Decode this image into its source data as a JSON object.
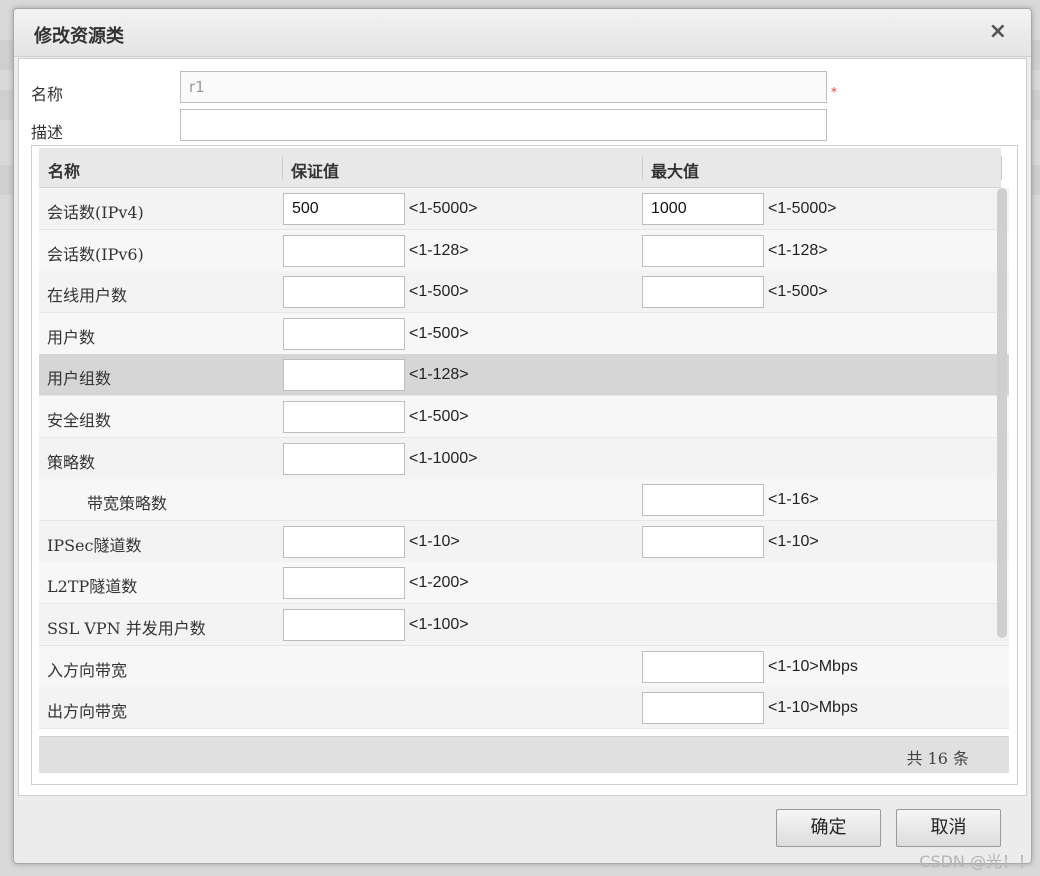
{
  "dialog": {
    "title": "修改资源类",
    "close_glyph": "×"
  },
  "form": {
    "name_label": "名称",
    "name_value": "r1",
    "required_mark": "*",
    "desc_label": "描述",
    "desc_value": ""
  },
  "grid": {
    "columns": {
      "name": "名称",
      "guarantee": "保证值",
      "max": "最大值"
    },
    "rows": [
      {
        "name": "会话数(IPv4)",
        "guarantee": "500",
        "guarantee_range": "<1-5000>",
        "max": "1000",
        "max_range": "<1-5000>"
      },
      {
        "name": "会话数(IPv6)",
        "guarantee": "",
        "guarantee_range": "<1-128>",
        "max": "",
        "max_range": "<1-128>"
      },
      {
        "name": "在线用户数",
        "guarantee": "",
        "guarantee_range": "<1-500>",
        "max": "",
        "max_range": "<1-500>"
      },
      {
        "name": "用户数",
        "guarantee": "",
        "guarantee_range": "<1-500>"
      },
      {
        "name": "用户组数",
        "guarantee": "",
        "guarantee_range": "<1-128>"
      },
      {
        "name": "安全组数",
        "guarantee": "",
        "guarantee_range": "<1-500>"
      },
      {
        "name": "策略数",
        "guarantee": "",
        "guarantee_range": "<1-1000>"
      },
      {
        "name": "带宽策略数",
        "max": "",
        "max_range": "<1-16>"
      },
      {
        "name": "IPSec隧道数",
        "guarantee": "",
        "guarantee_range": "<1-10>",
        "max": "",
        "max_range": "<1-10>"
      },
      {
        "name": "L2TP隧道数",
        "guarantee": "",
        "guarantee_range": "<1-200>"
      },
      {
        "name": "SSL VPN 并发用户数",
        "guarantee": "",
        "guarantee_range": "<1-100>"
      },
      {
        "name": "入方向带宽",
        "max": "",
        "max_range": "<1-10>Mbps"
      },
      {
        "name": "出方向带宽",
        "max": "",
        "max_range": "<1-10>Mbps"
      }
    ],
    "footer_total": "共 16 条"
  },
  "buttons": {
    "ok": "确定",
    "cancel": "取消"
  },
  "watermark": "CSDN @光！！"
}
